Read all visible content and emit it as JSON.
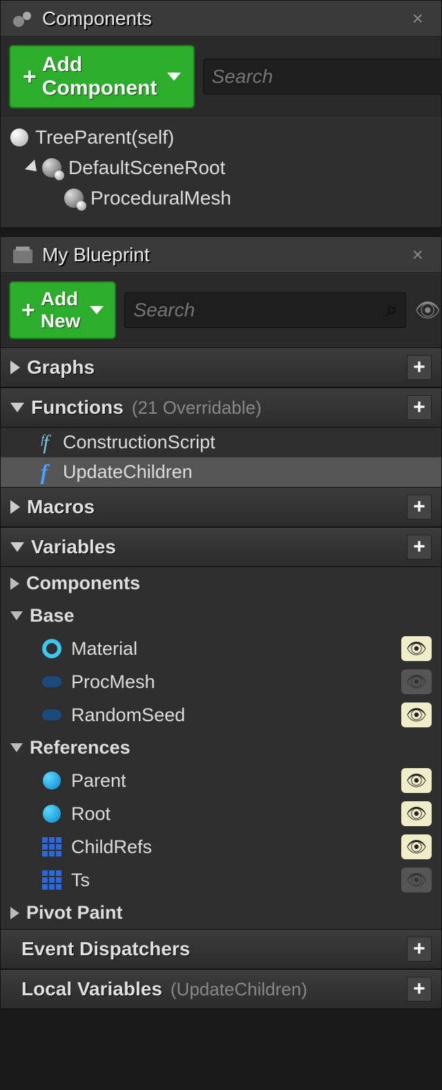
{
  "components": {
    "title": "Components",
    "add_btn": "Add Component",
    "search_placeholder": "Search",
    "tree": {
      "self": "TreeParent(self)",
      "root": "DefaultSceneRoot",
      "child": "ProceduralMesh"
    }
  },
  "blueprint": {
    "title": "My Blueprint",
    "add_btn": "Add New",
    "search_placeholder": "Search",
    "sections": {
      "graphs": "Graphs",
      "functions": {
        "title": "Functions",
        "subtitle": "(21 Overridable)"
      },
      "macros": "Macros",
      "variables": "Variables",
      "event_dispatchers": "Event Dispatchers",
      "local_vars": {
        "title": "Local Variables",
        "subtitle": "(UpdateChildren)"
      }
    },
    "functions": [
      {
        "name": "ConstructionScript"
      },
      {
        "name": "UpdateChildren"
      }
    ],
    "var_groups": {
      "components": "Components",
      "base": "Base",
      "references": "References",
      "pivot_paint": "Pivot Paint"
    },
    "base_vars": [
      {
        "name": "Material",
        "icon": "ring",
        "visible": true
      },
      {
        "name": "ProcMesh",
        "icon": "pill-dark",
        "visible": false
      },
      {
        "name": "RandomSeed",
        "icon": "pill-dark",
        "visible": true
      }
    ],
    "ref_vars": [
      {
        "name": "Parent",
        "icon": "ball-blue",
        "visible": true
      },
      {
        "name": "Root",
        "icon": "ball-blue",
        "visible": true
      },
      {
        "name": "ChildRefs",
        "icon": "grid-blue",
        "visible": true
      },
      {
        "name": "Ts",
        "icon": "grid-blue",
        "visible": false
      }
    ]
  }
}
